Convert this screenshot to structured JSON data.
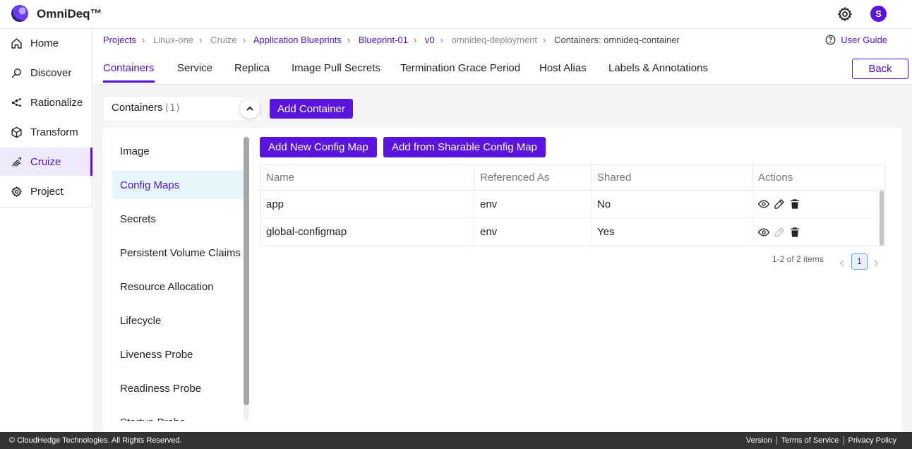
{
  "app": {
    "title": "OmniDeq™",
    "avatar_letter": "S"
  },
  "sidebar": {
    "items": [
      {
        "label": "Home",
        "icon": "home-icon"
      },
      {
        "label": "Discover",
        "icon": "discover-icon"
      },
      {
        "label": "Rationalize",
        "icon": "rationalize-icon"
      },
      {
        "label": "Transform",
        "icon": "cube-icon"
      },
      {
        "label": "Cruize",
        "icon": "cruize-icon",
        "active": true
      },
      {
        "label": "Project",
        "icon": "gear-icon"
      }
    ]
  },
  "breadcrumb": {
    "items": [
      "Projects",
      "Linux-one",
      "Cruize",
      "Application Blueprints",
      "Blueprint-01",
      "v0",
      "omnideq-deployment",
      "Containers: omnideq-container"
    ],
    "user_guide": "User Guide"
  },
  "tabs": {
    "items": [
      "Containers",
      "Service",
      "Replica",
      "Image Pull Secrets",
      "Termination Grace Period",
      "Host Alias",
      "Labels & Annotations"
    ],
    "active": "Containers",
    "back_label": "Back"
  },
  "containers": {
    "label": "Containers",
    "count": "(1)",
    "add_label": "Add Container"
  },
  "subnav": {
    "items": [
      "Image",
      "Config Maps",
      "Secrets",
      "Persistent Volume Claims",
      "Resource Allocation",
      "Lifecycle",
      "Liveness Probe",
      "Readiness Probe",
      "Startup Probe"
    ],
    "active": "Config Maps"
  },
  "config_maps": {
    "add_new_label": "Add New Config Map",
    "add_sharable_label": "Add from Sharable Config Map",
    "columns": [
      "Name",
      "Referenced As",
      "Shared",
      "Actions"
    ],
    "rows": [
      {
        "name": "app",
        "referenced_as": "env",
        "shared": "No"
      },
      {
        "name": "global-configmap",
        "referenced_as": "env",
        "shared": "Yes"
      }
    ],
    "pagination": {
      "summary": "1-2 of 2 items",
      "page": "1"
    }
  },
  "footer": {
    "copyright": "© CloudHedge Technologies. All Rights Reserved.",
    "links": [
      "Version",
      "Terms of Service",
      "Privacy Policy"
    ]
  },
  "colors": {
    "accent": "#5b14e0",
    "active_bg": "#efeafd",
    "footer_bg": "#333333"
  }
}
